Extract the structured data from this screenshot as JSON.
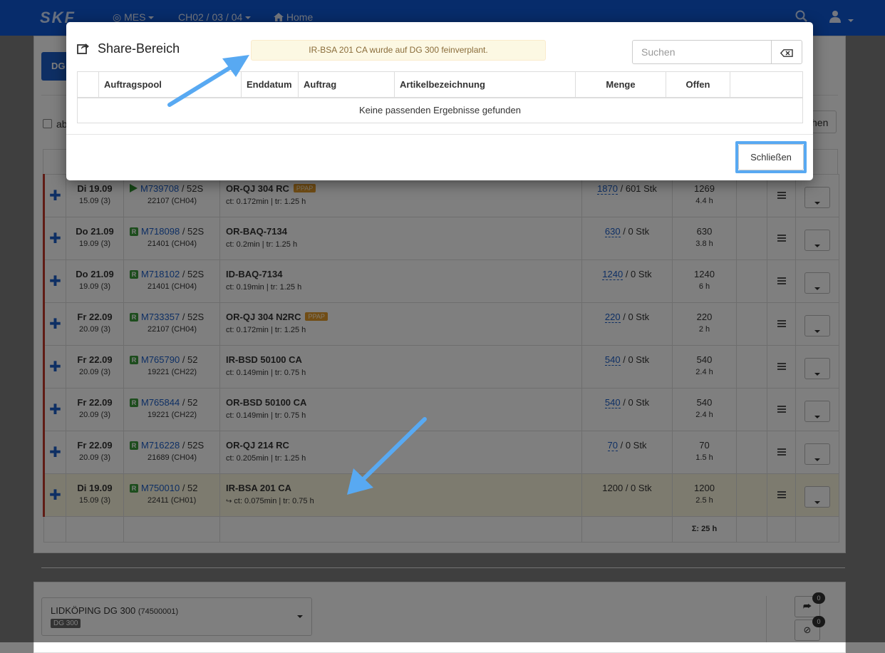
{
  "navbar": {
    "brand": "SKF",
    "mes_label": "MES",
    "location_label": "CH02 / 03 / 04",
    "home_label": "Home"
  },
  "background": {
    "dg_button": "DG",
    "checkbox_label": "ab",
    "right_button": "hen",
    "orders": [
      {
        "date": "Di 19.09",
        "date_sub": "15.09 (3)",
        "status_icon": "play-icon",
        "order": "M739708",
        "order_suffix": " / 52S",
        "order_sub": "22107 (CH04)",
        "article": "OR-QJ 304 RC",
        "badge": "PPAP",
        "article_sub": "ct: 0.172min | tr: 1.25 h",
        "qty_link": "1870",
        "qty_rest": " / 601 Stk",
        "open": "1269",
        "open_sub": "4.4 h"
      },
      {
        "date": "Do 21.09",
        "date_sub": "19.09 (3)",
        "status_icon": "r-icon",
        "order": "M718098",
        "order_suffix": " / 52S",
        "order_sub": "21401 (CH04)",
        "article": "OR-BAQ-7134",
        "badge": "",
        "article_sub": "ct: 0.2min | tr: 1.25 h",
        "qty_link": "630",
        "qty_rest": " / 0 Stk",
        "open": "630",
        "open_sub": "3.8 h"
      },
      {
        "date": "Do 21.09",
        "date_sub": "19.09 (3)",
        "status_icon": "r-icon",
        "order": "M718102",
        "order_suffix": " / 52S",
        "order_sub": "21401 (CH04)",
        "article": "ID-BAQ-7134",
        "badge": "",
        "article_sub": "ct: 0.19min | tr: 1.25 h",
        "qty_link": "1240",
        "qty_rest": " / 0 Stk",
        "open": "1240",
        "open_sub": "6 h"
      },
      {
        "date": "Fr 22.09",
        "date_sub": "20.09 (3)",
        "status_icon": "r-icon",
        "order": "M733357",
        "order_suffix": " / 52S",
        "order_sub": "22107 (CH04)",
        "article": "OR-QJ 304 N2RC",
        "badge": "PPAP",
        "article_sub": "ct: 0.172min | tr: 1.25 h",
        "qty_link": "220",
        "qty_rest": " / 0 Stk",
        "open": "220",
        "open_sub": "2 h"
      },
      {
        "date": "Fr 22.09",
        "date_sub": "20.09 (3)",
        "status_icon": "r-icon",
        "order": "M765790",
        "order_suffix": " / 52",
        "order_sub": "19221 (CH22)",
        "article": "IR-BSD 50100 CA",
        "badge": "",
        "article_sub": "ct: 0.149min | tr: 0.75 h",
        "qty_link": "540",
        "qty_rest": " / 0 Stk",
        "open": "540",
        "open_sub": "2.4 h"
      },
      {
        "date": "Fr 22.09",
        "date_sub": "20.09 (3)",
        "status_icon": "r-icon",
        "order": "M765844",
        "order_suffix": " / 52",
        "order_sub": "19221 (CH22)",
        "article": "OR-BSD 50100 CA",
        "badge": "",
        "article_sub": "ct: 0.149min | tr: 0.75 h",
        "qty_link": "540",
        "qty_rest": " / 0 Stk",
        "open": "540",
        "open_sub": "2.4 h"
      },
      {
        "date": "Fr 22.09",
        "date_sub": "20.09 (3)",
        "status_icon": "r-icon",
        "order": "M716228",
        "order_suffix": " / 52S",
        "order_sub": "21689 (CH04)",
        "article": "OR-QJ 214 RC",
        "badge": "",
        "article_sub": "ct: 0.205min | tr: 1.25 h",
        "qty_link": "70",
        "qty_rest": " / 0 Stk",
        "open": "70",
        "open_sub": "1.5 h"
      },
      {
        "date": "Di 19.09",
        "date_sub": "15.09 (3)",
        "status_icon": "r-icon",
        "order": "M750010",
        "order_suffix": " / 52",
        "order_sub": "22411 (CH01)",
        "article": "IR-BSA 201 CA",
        "badge": "",
        "article_sub": "ct: 0.075min | tr: 0.75 h",
        "shared": true,
        "qty_link": "",
        "qty_rest": "1200 / 0 Stk",
        "open": "1200",
        "open_sub": "2.5 h",
        "highlight": true
      }
    ],
    "sum_label": "Σ: 25 h",
    "line_select": {
      "name": "LIDKÖPING DG 300",
      "code": "(74500001)",
      "badge": "DG 300"
    },
    "side_badges": [
      "0",
      "0"
    ]
  },
  "modal": {
    "title": "Share-Bereich",
    "alert": "IR-BSA 201 CA wurde auf DG 300 feinverplant.",
    "search_placeholder": "Suchen",
    "columns": [
      "",
      "Auftragspool",
      "Enddatum",
      "Auftrag",
      "Artikelbezeichnung",
      "Menge",
      "Offen",
      ""
    ],
    "empty_message": "Keine passenden Ergebnisse gefunden",
    "close_label": "Schließen"
  },
  "colors": {
    "navbar": "#0f58d6",
    "accent_link": "#1c5fc9",
    "alert_bg": "#fcf8e3",
    "alert_text": "#8a6d3b",
    "arrow": "#58a9f2",
    "highlight_row": "#fbf6de",
    "priority_bar": "#c0392b"
  }
}
